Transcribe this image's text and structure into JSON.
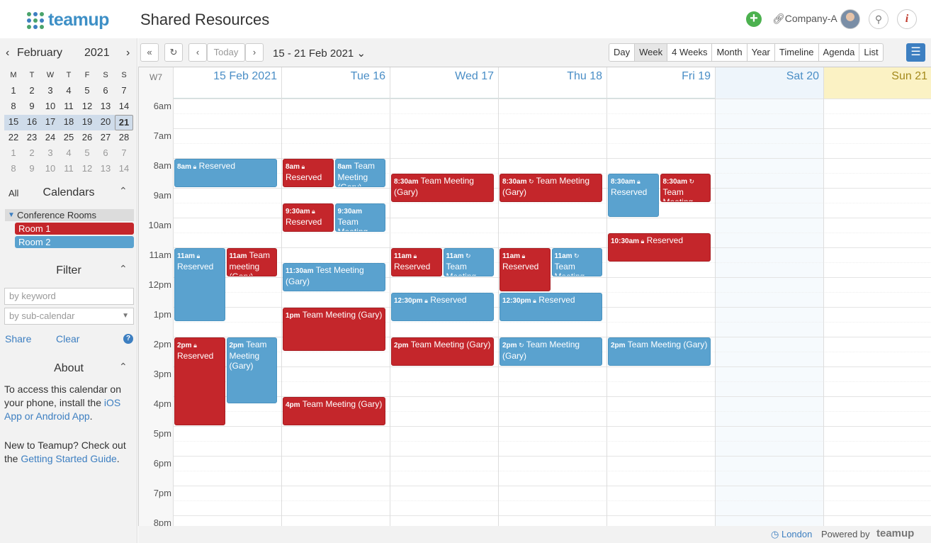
{
  "app": {
    "logo_text": "teamup",
    "title": "Shared Resources",
    "company": "Company-A",
    "add_icon": "plus-icon",
    "link_icon": "link-icon",
    "search_icon": "search-icon",
    "info_icon": "info-icon"
  },
  "mini_calendar": {
    "month": "February",
    "year": "2021",
    "dow": [
      "M",
      "T",
      "W",
      "T",
      "F",
      "S",
      "S"
    ],
    "weeks": [
      [
        "1",
        "2",
        "3",
        "4",
        "5",
        "6",
        "7"
      ],
      [
        "8",
        "9",
        "10",
        "11",
        "12",
        "13",
        "14"
      ],
      [
        "15",
        "16",
        "17",
        "18",
        "19",
        "20",
        "21"
      ],
      [
        "22",
        "23",
        "24",
        "25",
        "26",
        "27",
        "28"
      ],
      [
        "1",
        "2",
        "3",
        "4",
        "5",
        "6",
        "7"
      ],
      [
        "8",
        "9",
        "10",
        "11",
        "12",
        "13",
        "14"
      ]
    ],
    "selected": "21"
  },
  "calendars": {
    "all_label": "All",
    "title": "Calendars",
    "group": "Conference Rooms",
    "rooms": [
      {
        "label": "Room 1",
        "color": "#c4262b"
      },
      {
        "label": "Room 2",
        "color": "#5aa2cf"
      }
    ]
  },
  "filter": {
    "title": "Filter",
    "keyword_placeholder": "by keyword",
    "subcal_placeholder": "by sub-calendar",
    "share": "Share",
    "clear": "Clear",
    "help": "?"
  },
  "about": {
    "title": "About",
    "p1_text": "To access this calendar on your phone, install the ",
    "p1_link": "iOS App or Android App",
    "p1_end": ".",
    "p2_text": "New to Teamup? Check out the ",
    "p2_link": "Getting Started Guide",
    "p2_end": "."
  },
  "toolbar": {
    "today": "Today",
    "date_range": "15 - 21 Feb 2021",
    "views": [
      "Day",
      "Week",
      "4 Weeks",
      "Month",
      "Year",
      "Timeline",
      "Agenda",
      "List"
    ],
    "active_view": "Week"
  },
  "calendar": {
    "week_label": "W7",
    "days": [
      "15 Feb 2021",
      "Tue 16",
      "Wed 17",
      "Thu 18",
      "Fri 19",
      "Sat 20",
      "Sun 21"
    ],
    "hours": [
      "6am",
      "7am",
      "8am",
      "9am",
      "10am",
      "11am",
      "12pm",
      "1pm",
      "2pm",
      "3pm",
      "4pm",
      "5pm",
      "6pm",
      "7pm",
      "8pm"
    ],
    "events": [
      {
        "day": 0,
        "start": 8,
        "end": 9,
        "lane": 0,
        "lanes": 1,
        "color": "b",
        "time": "8am",
        "lock": true,
        "title": "Reserved",
        "inline": true
      },
      {
        "day": 0,
        "start": 11,
        "end": 13.5,
        "lane": 0,
        "lanes": 2,
        "color": "b",
        "time": "11am",
        "lock": true,
        "title": "Reserved"
      },
      {
        "day": 0,
        "start": 11,
        "end": 12,
        "lane": 1,
        "lanes": 2,
        "color": "r",
        "time": "11am",
        "title": "Team meeting (Gary)",
        "inline": true
      },
      {
        "day": 0,
        "start": 14,
        "end": 17,
        "lane": 0,
        "lanes": 2,
        "color": "r",
        "time": "2pm",
        "lock": true,
        "title": "Reserved"
      },
      {
        "day": 0,
        "start": 14,
        "end": 16.25,
        "lane": 1,
        "lanes": 2,
        "color": "b",
        "time": "2pm",
        "title": "Team Meeting (Gary)",
        "inline": true
      },
      {
        "day": 1,
        "start": 8,
        "end": 9,
        "lane": 0,
        "lanes": 2,
        "color": "r",
        "time": "8am",
        "lock": true,
        "title": "Reserved"
      },
      {
        "day": 1,
        "start": 8,
        "end": 9,
        "lane": 1,
        "lanes": 2,
        "color": "b",
        "time": "8am",
        "title": "Team Meeting (Gary)",
        "inline": true
      },
      {
        "day": 1,
        "start": 9.5,
        "end": 10.5,
        "lane": 0,
        "lanes": 2,
        "color": "r",
        "time": "9:30am",
        "lock": true,
        "title": "Reserved"
      },
      {
        "day": 1,
        "start": 9.5,
        "end": 10.5,
        "lane": 1,
        "lanes": 2,
        "color": "b",
        "time": "9:30am",
        "title": "Team Meeting (Gary)",
        "inline": true
      },
      {
        "day": 1,
        "start": 11.5,
        "end": 12.5,
        "lane": 0,
        "lanes": 1,
        "color": "b",
        "time": "11:30am",
        "title": "Test Meeting (Gary)",
        "inline": true
      },
      {
        "day": 1,
        "start": 13,
        "end": 14.5,
        "lane": 0,
        "lanes": 1,
        "color": "r",
        "time": "1pm",
        "title": "Team Meeting (Gary)",
        "inline": true
      },
      {
        "day": 1,
        "start": 16,
        "end": 17,
        "lane": 0,
        "lanes": 1,
        "color": "r",
        "time": "4pm",
        "title": "Team Meeting (Gary)",
        "inline": true
      },
      {
        "day": 2,
        "start": 8.5,
        "end": 9.5,
        "lane": 0,
        "lanes": 1,
        "color": "r",
        "time": "8:30am",
        "title": "Team Meeting (Gary)",
        "inline": true
      },
      {
        "day": 2,
        "start": 11,
        "end": 12,
        "lane": 0,
        "lanes": 2,
        "color": "r",
        "time": "11am",
        "lock": true,
        "title": "Reserved"
      },
      {
        "day": 2,
        "start": 11,
        "end": 12,
        "lane": 1,
        "lanes": 2,
        "color": "b",
        "time": "11am",
        "repeat": true,
        "title": "Team Meeting (Gary)"
      },
      {
        "day": 2,
        "start": 12.5,
        "end": 13.5,
        "lane": 0,
        "lanes": 1,
        "color": "b",
        "time": "12:30pm",
        "lock": true,
        "title": "Reserved",
        "inline": true
      },
      {
        "day": 2,
        "start": 14,
        "end": 15,
        "lane": 0,
        "lanes": 1,
        "color": "r",
        "time": "2pm",
        "title": "Team Meeting (Gary)",
        "inline": true
      },
      {
        "day": 3,
        "start": 8.5,
        "end": 9.5,
        "lane": 0,
        "lanes": 1,
        "color": "r",
        "time": "8:30am",
        "repeat": true,
        "title": "Team Meeting (Gary)",
        "inline": true
      },
      {
        "day": 3,
        "start": 11,
        "end": 12.5,
        "lane": 0,
        "lanes": 2,
        "color": "r",
        "time": "11am",
        "lock": true,
        "title": "Reserved"
      },
      {
        "day": 3,
        "start": 11,
        "end": 12,
        "lane": 1,
        "lanes": 2,
        "color": "b",
        "time": "11am",
        "repeat": true,
        "title": "Team Meeting (Gary)"
      },
      {
        "day": 3,
        "start": 12.5,
        "end": 13.5,
        "lane": 0,
        "lanes": 1,
        "color": "b",
        "time": "12:30pm",
        "lock": true,
        "title": "Reserved",
        "inline": true
      },
      {
        "day": 3,
        "start": 14,
        "end": 15,
        "lane": 0,
        "lanes": 1,
        "color": "b",
        "time": "2pm",
        "repeat": true,
        "title": "Team Meeting (Gary)",
        "inline": true
      },
      {
        "day": 4,
        "start": 8.5,
        "end": 10,
        "lane": 0,
        "lanes": 2,
        "color": "b",
        "time": "8:30am",
        "lock": true,
        "title": "Reserved"
      },
      {
        "day": 4,
        "start": 8.5,
        "end": 9.5,
        "lane": 1,
        "lanes": 2,
        "color": "r",
        "time": "8:30am",
        "repeat": true,
        "title": "Team Meeting (Gary)"
      },
      {
        "day": 4,
        "start": 10.5,
        "end": 11.5,
        "lane": 0,
        "lanes": 1,
        "color": "r",
        "time": "10:30am",
        "lock": true,
        "title": "Reserved",
        "inline": true
      },
      {
        "day": 4,
        "start": 14,
        "end": 15,
        "lane": 0,
        "lanes": 1,
        "color": "b",
        "time": "2pm",
        "title": "Team Meeting (Gary)",
        "inline": true
      }
    ]
  },
  "footer": {
    "timezone": "London",
    "powered_by": "Powered by",
    "brand": "teamup"
  }
}
